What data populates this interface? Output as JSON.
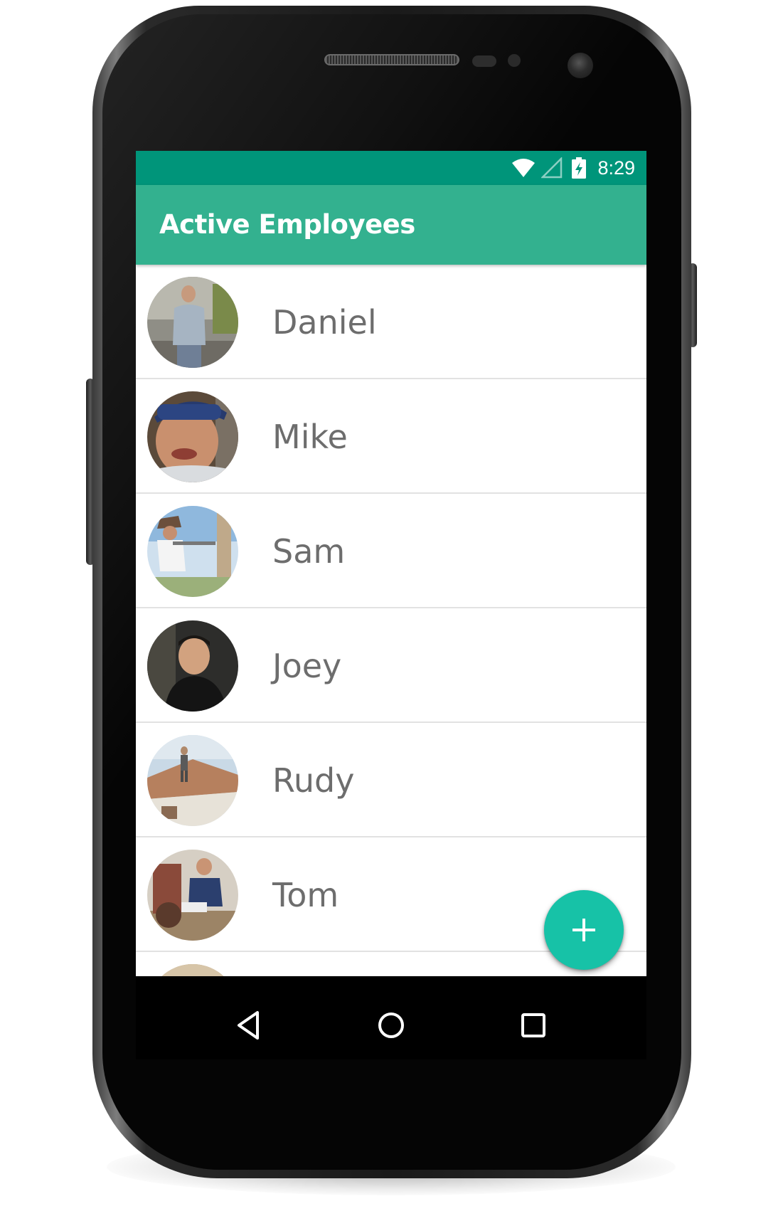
{
  "status_bar": {
    "time": "8:29",
    "icons": [
      "wifi-icon",
      "cell-signal-icon",
      "battery-charging-icon"
    ],
    "color": "#00957a"
  },
  "app_bar": {
    "title": "Active Employees",
    "color": "#33b18f"
  },
  "employees": [
    {
      "name": "Daniel",
      "avatar": "avatar-photo"
    },
    {
      "name": "Mike",
      "avatar": "avatar-photo"
    },
    {
      "name": "Sam",
      "avatar": "avatar-photo"
    },
    {
      "name": "Joey",
      "avatar": "avatar-photo"
    },
    {
      "name": "Rudy",
      "avatar": "avatar-photo"
    },
    {
      "name": "Tom",
      "avatar": "avatar-photo"
    },
    {
      "name": "",
      "avatar": "avatar-photo"
    }
  ],
  "fab": {
    "icon": "plus-icon",
    "color": "#17c2a7"
  },
  "nav_bar": {
    "icons": [
      "back-icon",
      "home-icon",
      "recents-icon"
    ]
  }
}
